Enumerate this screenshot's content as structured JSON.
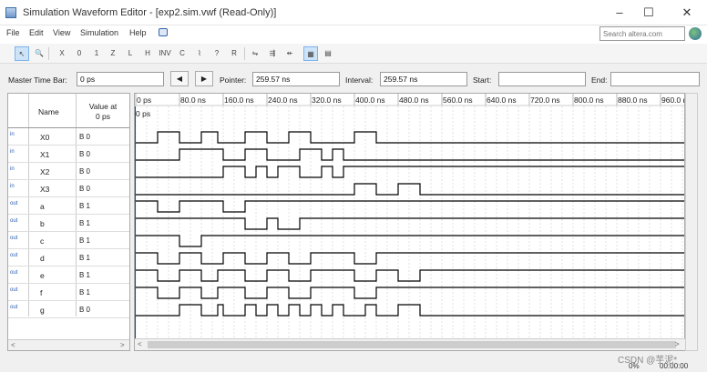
{
  "window": {
    "title": "Simulation Waveform Editor - [exp2.sim.vwf (Read-Only)]",
    "controls": {
      "minimize": "–",
      "maximize": "☐",
      "close": "✕"
    }
  },
  "menu": {
    "items": [
      "File",
      "Edit",
      "View",
      "Simulation",
      "Help"
    ]
  },
  "search": {
    "placeholder": "Search altera.com"
  },
  "toolbar": {
    "icons": [
      "select-tool-icon",
      "zoom-tool-icon",
      "forcing-unknown-icon",
      "forcing-low-icon",
      "forcing-high-icon",
      "high-impedance-icon",
      "weak-low-icon",
      "weak-high-icon",
      "invert-icon",
      "count-value-icon",
      "clock-icon",
      "random-value-icon",
      "arbitrary-value-icon",
      "snap-to-grid-icon",
      "group-icon",
      "ungroup-icon",
      "grid-on-icon",
      "waveform-view-icon"
    ]
  },
  "timebar": {
    "master_label": "Master Time Bar:",
    "master_value": "0 ps",
    "prev": "◀",
    "next": "▶",
    "pointer_label": "Pointer:",
    "pointer_value": "259.57 ns",
    "interval_label": "Interval:",
    "interval_value": "259.57 ns",
    "start_label": "Start:",
    "start_value": "",
    "end_label": "End:",
    "end_value": ""
  },
  "table": {
    "name_header": "Name",
    "value_header_line1": "Value at",
    "value_header_line2": "0 ps",
    "cursor_label": "0 ps"
  },
  "signals": [
    {
      "dir": "in",
      "name": "X0",
      "value": "B 0",
      "initial": 0,
      "toggles": [
        40,
        80,
        120,
        150,
        200,
        240,
        280,
        320,
        400,
        440
      ]
    },
    {
      "dir": "in",
      "name": "X1",
      "value": "B 0",
      "initial": 0,
      "toggles": [
        80,
        160,
        200,
        240,
        300,
        340,
        360,
        380
      ]
    },
    {
      "dir": "in",
      "name": "X2",
      "value": "B 0",
      "initial": 0,
      "toggles": [
        160,
        200,
        220,
        240,
        260,
        300,
        340,
        360,
        380
      ]
    },
    {
      "dir": "in",
      "name": "X3",
      "value": "B 0",
      "initial": 0,
      "toggles": [
        400,
        440,
        480,
        520
      ]
    },
    {
      "dir": "out",
      "name": "a",
      "value": "B 1",
      "initial": 1,
      "toggles": [
        40,
        80,
        160,
        200
      ]
    },
    {
      "dir": "out",
      "name": "b",
      "value": "B 1",
      "initial": 1,
      "toggles": [
        200,
        240,
        260,
        300
      ]
    },
    {
      "dir": "out",
      "name": "c",
      "value": "B 1",
      "initial": 1,
      "toggles": [
        80,
        120
      ]
    },
    {
      "dir": "out",
      "name": "d",
      "value": "B 1",
      "initial": 1,
      "toggles": [
        40,
        80,
        120,
        160,
        200,
        240,
        280,
        320,
        400,
        440
      ]
    },
    {
      "dir": "out",
      "name": "e",
      "value": "B 1",
      "initial": 1,
      "toggles": [
        40,
        80,
        120,
        150,
        200,
        240,
        280,
        320,
        400,
        440,
        480,
        520
      ]
    },
    {
      "dir": "out",
      "name": "f",
      "value": "B 1",
      "initial": 1,
      "toggles": [
        40,
        80,
        120,
        150,
        200,
        240,
        280,
        320,
        400,
        440
      ]
    },
    {
      "dir": "out",
      "name": "g",
      "value": "B 0",
      "initial": 0,
      "toggles": [
        80,
        120,
        150,
        160,
        200,
        220,
        240,
        260,
        280,
        300,
        320,
        340,
        360,
        380,
        420,
        440,
        480,
        520
      ]
    }
  ],
  "ruler": {
    "labels": [
      "0 ps",
      "80.0 ns",
      "160.0 ns",
      "240.0 ns",
      "320.0 ns",
      "400.0 ns",
      "480.0 ns",
      "560.0 ns",
      "640.0 ns",
      "720.0 ns",
      "800.0 ns",
      "880.0 ns",
      "960.0 ns"
    ],
    "max_ns": 1000
  },
  "status": {
    "progress": "0%",
    "time": "00:00:00"
  },
  "watermark": "CSDN @芋泥*"
}
